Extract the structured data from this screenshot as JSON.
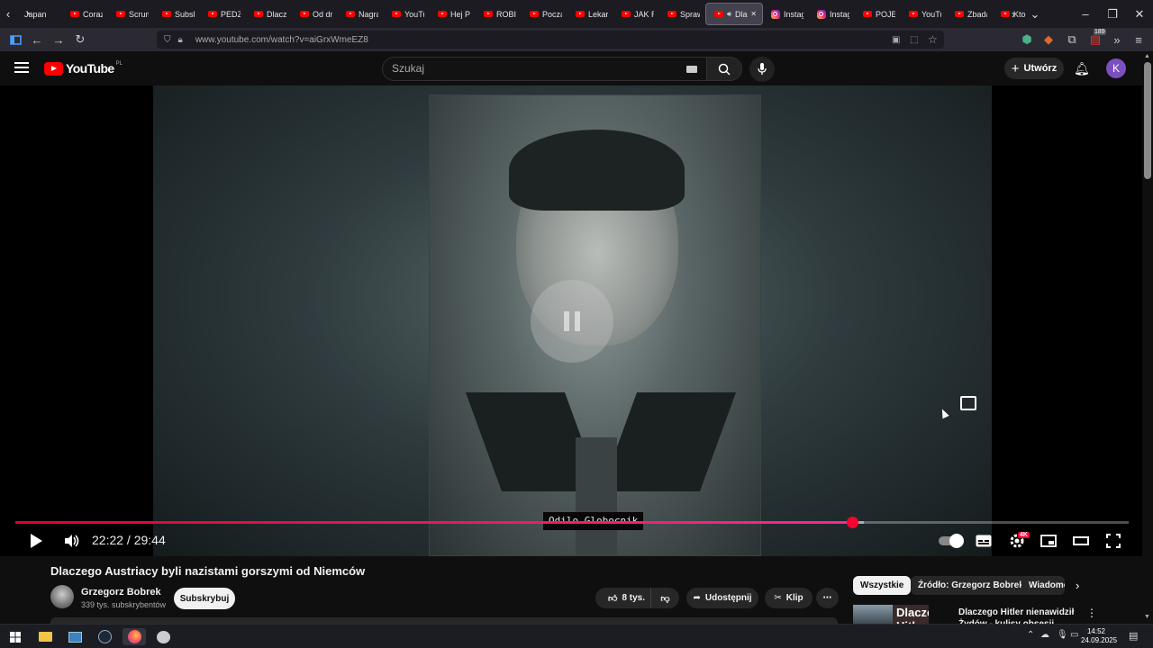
{
  "browser": {
    "tabs": [
      {
        "label": "Japan",
        "icon": "web-icon"
      },
      {
        "label": "Coraz",
        "icon": "youtube-icon"
      },
      {
        "label": "Scrum",
        "icon": "youtube-icon"
      },
      {
        "label": "Subsk",
        "icon": "youtube-icon"
      },
      {
        "label": "PEDZI",
        "icon": "youtube-icon"
      },
      {
        "label": "Dlacz",
        "icon": "youtube-icon"
      },
      {
        "label": "Od dr",
        "icon": "youtube-icon"
      },
      {
        "label": "Nagra",
        "icon": "youtube-icon"
      },
      {
        "label": "YouTu",
        "icon": "youtube-icon"
      },
      {
        "label": "Hej Pi",
        "icon": "youtube-icon"
      },
      {
        "label": "ROBIV",
        "icon": "youtube-icon"
      },
      {
        "label": "Począ",
        "icon": "youtube-icon"
      },
      {
        "label": "Lekarz",
        "icon": "youtube-icon"
      },
      {
        "label": "JAK R",
        "icon": "youtube-icon"
      },
      {
        "label": "Spraw",
        "icon": "youtube-icon"
      },
      {
        "label": "Dla",
        "icon": "youtube-icon",
        "active": true
      },
      {
        "label": "Instag",
        "icon": "instagram-icon"
      },
      {
        "label": "Instag",
        "icon": "instagram-icon"
      },
      {
        "label": "POJEC",
        "icon": "youtube-icon"
      },
      {
        "label": "YouTu",
        "icon": "youtube-icon"
      },
      {
        "label": "Zbada",
        "icon": "youtube-icon"
      },
      {
        "label": "Kto",
        "icon": "youtube-icon"
      }
    ],
    "url": "www.youtube.com/watch?v=aiGrxWmeEZ8",
    "extension_badge": "189"
  },
  "youtube": {
    "logo_text": "YouTube",
    "region": "PL",
    "search_placeholder": "Szukaj",
    "create_label": "Utwórz",
    "avatar_letter": "K"
  },
  "player": {
    "subtitle": "Odilo Globocnik",
    "current_time": "22:22",
    "duration": "29:44",
    "time_display": "22:22 / 29:44",
    "progress_fraction": 0.752,
    "buffered_fraction": 0.762,
    "quality_badge": "4K",
    "accent": "#ff0033"
  },
  "video": {
    "title": "Dlaczego Austriacy byli nazistami gorszymi od Niemców",
    "channel_name": "Grzegorz Bobrek",
    "channel_subs": "339 tys. subskrybentów",
    "subscribe_label": "Subskrybuj",
    "likes": "8 tys.",
    "share_label": "Udostępnij",
    "clip_label": "Klip"
  },
  "recommendations": {
    "chips": [
      "Wszystkie",
      "Źródło: Grzegorz Bobrek",
      "Wiadomo"
    ],
    "first_thumb_text": "Dlaczego Hitler",
    "first_title": "Dlaczego Hitler nienawidził Żydów - kulisy obsesji"
  },
  "taskbar": {
    "time": "14:52",
    "date": "24.09.2025"
  }
}
